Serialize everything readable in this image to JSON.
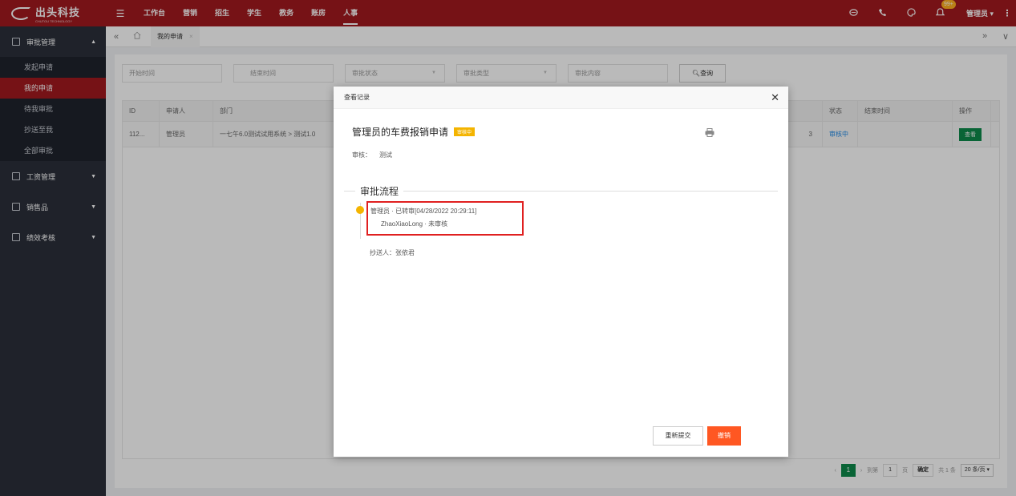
{
  "app": {
    "logo_text": "出头科技",
    "logo_subtext": "CHUTOU TECHNOLOGY"
  },
  "top_nav": [
    "工作台",
    "营销",
    "招生",
    "学生",
    "教务",
    "账房",
    "人事"
  ],
  "top_right": {
    "badge": "99+",
    "user": "管理员 ▾"
  },
  "sidebar": {
    "groups": [
      {
        "label": "审批管理",
        "expanded": true,
        "items": [
          "发起申请",
          "我的申请",
          "待我审批",
          "抄送至我",
          "全部审批"
        ],
        "active": "我的申请"
      },
      {
        "label": "工资管理",
        "expanded": false
      },
      {
        "label": "销售品",
        "expanded": false
      },
      {
        "label": "绩效考核",
        "expanded": false
      }
    ]
  },
  "tabs": {
    "current": "我的申请"
  },
  "filters": {
    "start": "开始时间",
    "end": "结束时间",
    "status": "审批状态",
    "type": "审批类型",
    "content": "审批内容",
    "query": "查询"
  },
  "table": {
    "headers": {
      "id": "ID",
      "applicant": "申请人",
      "dept": "部门",
      "status": "状态",
      "end_time": "结束时间",
      "action": "操作"
    },
    "rows": [
      {
        "id": "112...",
        "applicant": "管理员",
        "dept": "一七午6.0测试试用系统 > 测试1.0",
        "hidden_fragment": "3",
        "status": "审核中",
        "end_time": "",
        "action": "查看"
      }
    ]
  },
  "pager": {
    "current": "1",
    "goto_label": "到第",
    "goto_value": "1",
    "page_unit": "页",
    "confirm": "确定",
    "total": "共 1 条",
    "page_size": "20 条/页 ▾"
  },
  "modal": {
    "header": "查看记录",
    "request_title": "管理员的车费报销申请",
    "status_tag": "审核中",
    "review_label": "审核：",
    "review_value": "测试",
    "flow_title": "审批流程",
    "flow_main": "管理员 · 已转审[04/28/2022 20:29:11]",
    "flow_sub": "ZhaoXiaoLong · 未审核",
    "cc": "抄送人：张依君",
    "resubmit": "重新提交",
    "revoke": "撤销"
  },
  "colors": {
    "brand_red": "#a21a1f",
    "sidebar_bg": "#2b2f3a",
    "green": "#0d8a4b",
    "status_yellow": "#f4b400",
    "revoke_orange": "#ff5722",
    "highlight_red": "#e02020"
  }
}
